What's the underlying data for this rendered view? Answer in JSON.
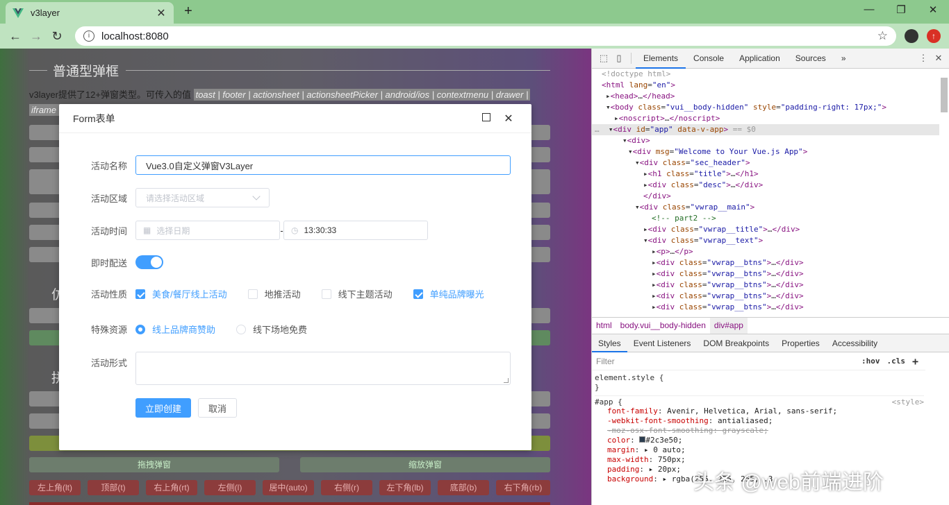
{
  "browser": {
    "tab_title": "v3layer",
    "tab_close": "✕",
    "new_tab": "+",
    "url": "localhost:8080",
    "window_controls": [
      "—",
      "❐",
      "✕"
    ]
  },
  "page": {
    "section_title": "普通型弹框",
    "desc_prefix": "v3layer提供了12+弹窗类型。可传入的值",
    "desc_types": "toast | footer | actionsheet | actionsheetPicker | android/ios | contextmenu | drawer |",
    "desc_line2": "iframe |",
    "frag1": "仿",
    "frag2": "拼",
    "buttons": [
      "拖拽弹窗",
      "缩放弹窗"
    ],
    "position_buttons": [
      "左上角(lt)",
      "顶部(t)",
      "右上角(rt)",
      "左侧(l)",
      "居中(auto)",
      "右侧(r)",
      "左下角(lb)",
      "底部(b)",
      "右下角(rb)"
    ]
  },
  "dialog": {
    "title": "Form表单",
    "max_icon": "maximize-icon",
    "close_icon": "✕",
    "fields": {
      "name_label": "活动名称",
      "name_value": "Vue3.0自定义弹窗V3Layer",
      "region_label": "活动区域",
      "region_placeholder": "请选择活动区域",
      "time_label": "活动时间",
      "date_placeholder": "选择日期",
      "time_sep": "-",
      "time_value": "13:30:33",
      "delivery_label": "即时配送",
      "delivery_on": true,
      "nature_label": "活动性质",
      "nature_options": [
        {
          "label": "美食/餐厅线上活动",
          "checked": true
        },
        {
          "label": "地推活动",
          "checked": false
        },
        {
          "label": "线下主题活动",
          "checked": false
        },
        {
          "label": "单纯品牌曝光",
          "checked": true
        }
      ],
      "resource_label": "特殊资源",
      "resource_options": [
        {
          "label": "线上品牌商赞助",
          "checked": true
        },
        {
          "label": "线下场地免费",
          "checked": false
        }
      ],
      "form_label": "活动形式"
    },
    "submit": "立即创建",
    "cancel": "取消"
  },
  "devtools": {
    "tabs": [
      "Elements",
      "Console",
      "Application",
      "Sources",
      "»"
    ],
    "breadcrumbs": [
      "html",
      "body.vui__body-hidden",
      "div#app"
    ],
    "style_tabs": [
      "Styles",
      "Event Listeners",
      "DOM Breakpoints",
      "Properties",
      "Accessibility"
    ],
    "filter_placeholder": "Filter",
    "filter_opts": [
      ":hov",
      ".cls",
      "+"
    ],
    "element_style": "element.style {",
    "rule_selector": "#app {",
    "rule_source": "<style>",
    "props": [
      {
        "n": "font-family",
        "v": "Avenir, Helvetica, Arial, sans-serif;",
        "strike": false
      },
      {
        "n": "-webkit-font-smoothing",
        "v": "antialiased;",
        "strike": false
      },
      {
        "n": "-moz-osx-font-smoothing",
        "v": "grayscale;",
        "strike": true
      },
      {
        "n": "color",
        "v": "#2c3e50;",
        "strike": false
      },
      {
        "n": "margin",
        "v": "▸ 0 auto;",
        "strike": false
      },
      {
        "n": "max-width",
        "v": "750px;",
        "strike": false
      },
      {
        "n": "padding",
        "v": "▸ 20px;",
        "strike": false
      },
      {
        "n": "background",
        "v": "▸ rgba(255, 255, 255, .3",
        "strike": false
      }
    ]
  },
  "watermark": "头条 @web前端进阶",
  "colors": {
    "primary": "#409eff",
    "tab_green": "#8dc98e"
  }
}
